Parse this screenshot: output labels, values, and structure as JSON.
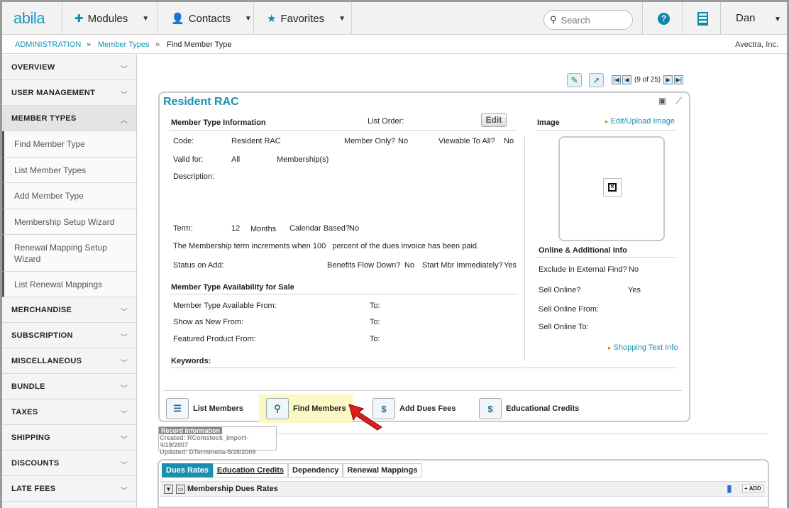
{
  "app": {
    "logo": "abila"
  },
  "topnav": {
    "modules": "Modules",
    "contacts": "Contacts",
    "favorites": "Favorites",
    "search_placeholder": "Search",
    "help": "?",
    "user": "Dan"
  },
  "breadcrumb": {
    "items": [
      "ADMINISTRATION",
      "Member Types",
      "Find Member Type"
    ],
    "sep": "»",
    "org": "Avectra, Inc."
  },
  "sidebar": {
    "sections": [
      "OVERVIEW",
      "USER MANAGEMENT",
      "MEMBER TYPES"
    ],
    "sub": [
      "Find Member Type",
      "List Member Types",
      "Add Member Type",
      "Membership Setup Wizard",
      "Renewal Mapping Setup Wizard",
      "List Renewal Mappings"
    ],
    "more": [
      "MERCHANDISE",
      "SUBSCRIPTION",
      "MISCELLANEOUS",
      "BUNDLE",
      "TAXES",
      "SHIPPING",
      "DISCOUNTS",
      "LATE FEES"
    ]
  },
  "pager": {
    "text": "(9 of 25)"
  },
  "card": {
    "title": "Resident RAC",
    "info_header": "Member Type Information",
    "list_order_label": "List Order:",
    "edit_label": "Edit",
    "code_label": "Code:",
    "code_value": "Resident RAC",
    "member_only_label": "Member Only?",
    "member_only_value": "No",
    "viewable_label": "Viewable To All?",
    "viewable_value": "No",
    "valid_for_label": "Valid for:",
    "valid_for_value": "All",
    "memberships_label": "Membership(s)",
    "description_label": "Description:",
    "term_label": "Term:",
    "term_value": "12",
    "term_unit": "Months",
    "calendar_label": "Calendar Based?",
    "calendar_value": "No",
    "increments_text": "The Membership term increments when 100   percent of the dues invoice has been paid.",
    "status_label": "Status on Add:",
    "benefits_label": "Benefits Flow Down?",
    "benefits_value": "No",
    "start_label": "Start Mbr Immediately?",
    "start_value": "Yes",
    "avail_header": "Member Type Availability for Sale",
    "avail_from_label": "Member Type Available From:",
    "new_from_label": "Show as New From:",
    "featured_label": "Featured Product From:",
    "to_label": "To:",
    "keywords_label": "Keywords:",
    "image_header": "Image",
    "edit_image_link": "Edit/Upload Image",
    "online_header": "Online & Additional Info",
    "exclude_label": "Exclude in External Find?",
    "exclude_value": "No",
    "sell_online_label": "Sell Online?",
    "sell_online_value": "Yes",
    "sell_from_label": "Sell Online From:",
    "sell_to_label": "Sell Online To:",
    "shopping_link": "Shopping Text Info"
  },
  "actions": {
    "list_members": "List Members",
    "find_members": "Find Members",
    "add_dues": "Add Dues Fees",
    "edu_credits": "Educational Credits"
  },
  "record": {
    "header": "Record Information",
    "created": "Created: RComstock_Import-4/19/2007",
    "updated": "Updated: DTerminella-5/28/2009"
  },
  "tabs": {
    "items": [
      "Dues Rates",
      "Education Credits",
      "Dependency",
      "Renewal Mappings"
    ],
    "sub_title": "Membership Dues Rates",
    "add_label": "ADD"
  }
}
